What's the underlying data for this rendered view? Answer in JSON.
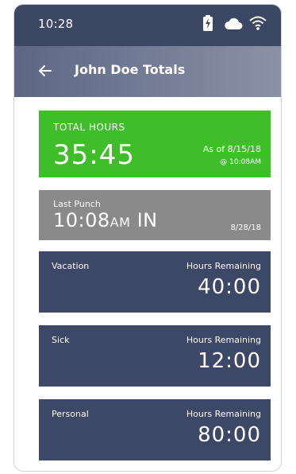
{
  "status_bar": {
    "time": "10:28",
    "icons": [
      "battery-charging-icon",
      "cloud-icon",
      "wifi-icon"
    ]
  },
  "app_bar": {
    "title": "John Doe Totals",
    "back_icon": "arrow-left-icon"
  },
  "total_hours": {
    "label": "TOTAL HOURS",
    "value": "35:45",
    "as_of": "As of 8/15/18",
    "at_time": "@ 10:08AM"
  },
  "last_punch": {
    "label": "Last Punch",
    "time": "10:08",
    "ampm": "AM",
    "direction": "IN",
    "date": "8/28/18"
  },
  "balances": [
    {
      "name": "Vacation",
      "label": "Hours Remaining",
      "value": "40:00"
    },
    {
      "name": "Sick",
      "label": "Hours Remaining",
      "value": "12:00"
    },
    {
      "name": "Personal",
      "label": "Hours Remaining",
      "value": "80:00"
    }
  ],
  "colors": {
    "status_bar": "#3b4763",
    "total_card": "#3fbe2a",
    "punch_card": "#8a8a8a",
    "balance_card": "#3d4866"
  }
}
